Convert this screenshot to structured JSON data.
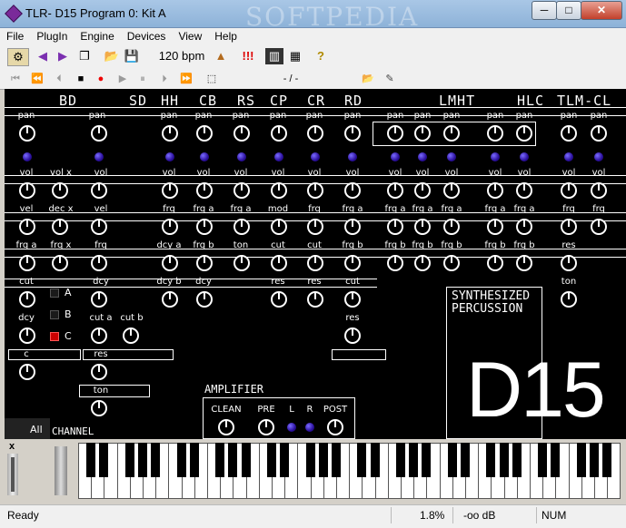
{
  "window": {
    "title": "TLR- D15 Program 0: Kit A",
    "watermark": "SOFTPEDIA",
    "minimize": "─",
    "maximize": "□",
    "close": "✕"
  },
  "menu": [
    "File",
    "PlugIn",
    "Engine",
    "Devices",
    "View",
    "Help"
  ],
  "toolbar": {
    "tempo": "120 bpm",
    "alert": "!!!",
    "help": "?"
  },
  "transport": {
    "position": "- / -"
  },
  "channels": [
    "BD",
    "SD",
    "HH",
    "CB",
    "RS",
    "CP",
    "CR",
    "RD",
    "LMHT",
    "HLC",
    "TLM-CL"
  ],
  "params": {
    "pan": "pan",
    "vol": "vol",
    "volx": "vol x",
    "vel": "vel",
    "decx": "dec x",
    "frq": "frq",
    "frqa": "frq a",
    "frqx": "frq x",
    "frqb": "frq b",
    "mod": "mod",
    "dcya": "dcy a",
    "dcyb": "dcy b",
    "dcy": "dcy",
    "ton": "ton",
    "cut": "cut",
    "res": "res",
    "cuta": "cut a",
    "cutb": "cut b",
    "c": "c"
  },
  "bd_selector": {
    "options": [
      "A",
      "B",
      "C"
    ],
    "selected": "C"
  },
  "branding": {
    "line1": "SYNTHESIZED",
    "line2": "PERCUSSION",
    "model": "D15"
  },
  "amplifier": {
    "title": "AMPLIFIER",
    "labels": [
      "CLEAN",
      "PRE",
      "L",
      "R",
      "POST"
    ]
  },
  "bottom": {
    "all_tab": "All",
    "channel": "CHANNEL",
    "piano_close": "x"
  },
  "status": {
    "text": "Ready",
    "cpu": "1.8%",
    "level": "-oo dB",
    "num": "NUM"
  },
  "colors": {
    "panel": "#000000",
    "led": "#3a1fd0",
    "selected_led": "#cc0000"
  }
}
